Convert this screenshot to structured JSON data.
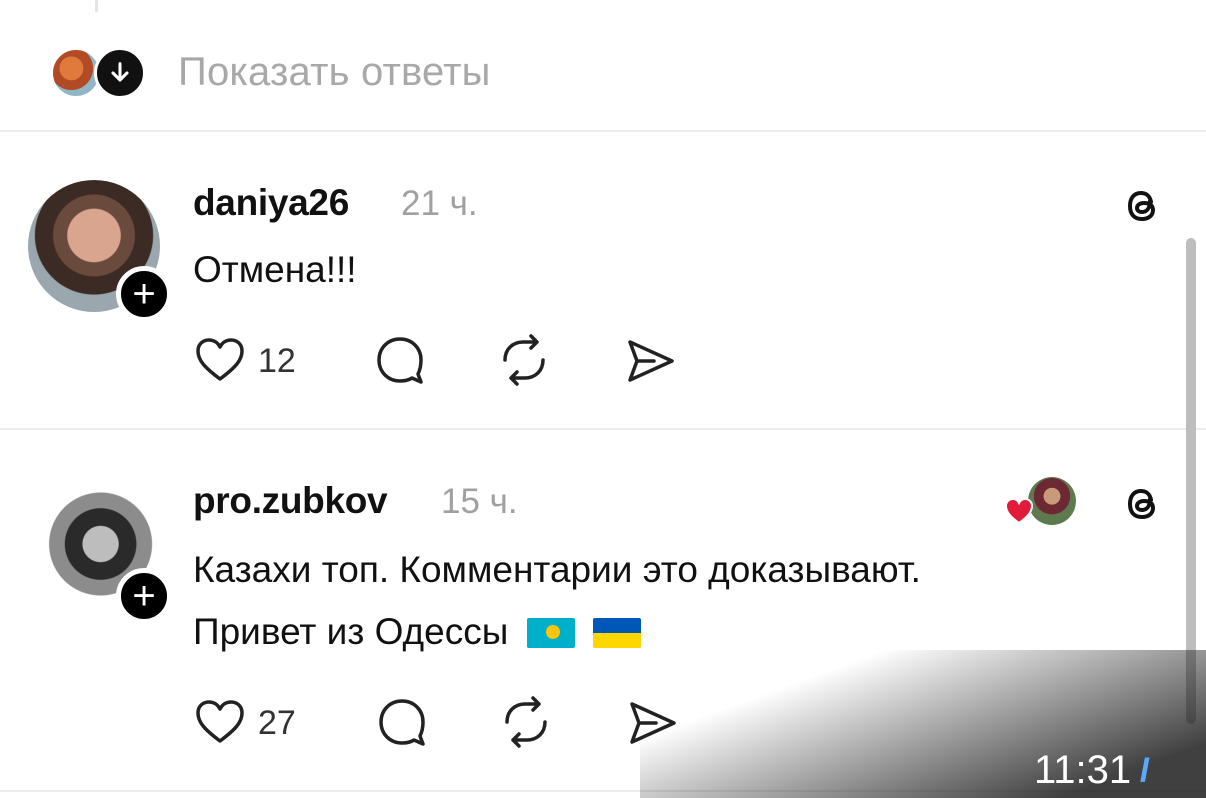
{
  "show_replies": {
    "label": "Показать ответы"
  },
  "posts": [
    {
      "username": "daniya26",
      "time": "21 ч.",
      "text_lines": [
        "Отмена!!!"
      ],
      "likes": "12"
    },
    {
      "username": "pro.zubkov",
      "time": "15 ч.",
      "text_lines": [
        "Казахи топ. Комментарии это доказывают.",
        "Привет из Одессы"
      ],
      "likes": "27",
      "flags": [
        "flag-kazakhstan-icon",
        "flag-ukraine-icon"
      ]
    }
  ],
  "status": {
    "time": "11:31",
    "ticks": "//"
  },
  "icons": {
    "like": "heart-icon",
    "comment": "comment-icon",
    "repost": "repost-icon",
    "share": "share-icon",
    "threads": "threads-icon",
    "follow": "plus-icon"
  },
  "colors": {
    "like_heart": "#e31b3b",
    "muted": "#a0a0a0",
    "tick": "#5aa9ff"
  }
}
